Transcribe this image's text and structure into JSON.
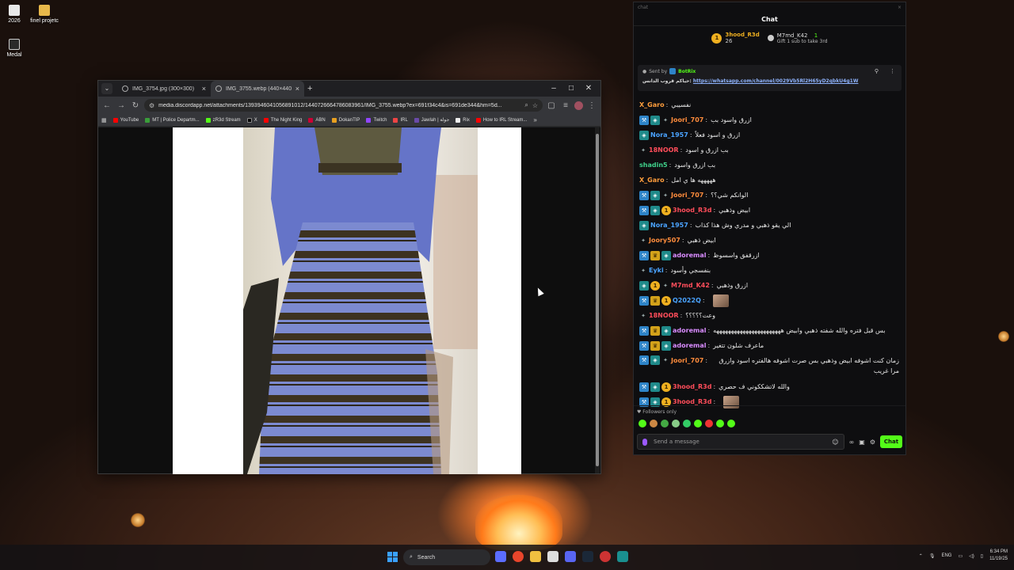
{
  "desktop": {
    "icons": [
      {
        "label": "2026",
        "icon": "file-icon"
      },
      {
        "label": "finel projetc",
        "icon": "folder-icon"
      },
      {
        "label": "Medal",
        "icon": "medal-app-icon"
      }
    ]
  },
  "browser": {
    "tabs": [
      {
        "label": "IMG_3754.jpg (300×300)",
        "active": false
      },
      {
        "label": "IMG_3755.webp (440×440)",
        "active": true
      }
    ],
    "url": "media.discordapp.net/attachments/1393946041056891012/1440726664786083961/IMG_3755.webp?ex=691f34c4&is=691de344&hm=5d...",
    "bookmarks": [
      "YouTube",
      "MT | Police Departm...",
      "zR3d Stream",
      "X",
      "The Night King",
      "ABN",
      "DokanTIP",
      "Twitch",
      "IRL",
      "Jawlah | جولة",
      "Rix",
      "How to IRL Stream..."
    ]
  },
  "chat": {
    "window_title": "chat",
    "header": "Chat",
    "gifters": [
      {
        "rank": "1",
        "name": "3hood_R3d",
        "count": "26"
      },
      {
        "rank": "",
        "name": "M7md_K42",
        "count": "1"
      }
    ],
    "gift_prompt": "Gift 1 sub to take 3rd",
    "pinned": {
      "sent_by_label": "Sent by",
      "sender": "BotRix",
      "text": "حياكم قروب الدانس",
      "link": "https://whatsapp.com/channel/0029Vb5Rl2H65yD2qbkU4g1W"
    },
    "messages": [
      {
        "user": "X_Garo",
        "color": "#ff9d3c",
        "badges": [],
        "text": "نفسيبي"
      },
      {
        "user": "Joori_707",
        "color": "#ff8c3c",
        "badges": [
          "mod",
          "sub",
          "og"
        ],
        "text": "ازرق واسود بب"
      },
      {
        "user": "Nora_1957",
        "color": "#4aa3ff",
        "badges": [
          "sub"
        ],
        "text": "ازرق و اسود فعلاً"
      },
      {
        "user": "18NOOR",
        "color": "#ff4d5a",
        "badges": [
          "og"
        ],
        "text": "بب ازرق و اسود"
      },
      {
        "user": "shadin5",
        "color": "#3fd08a",
        "badges": [],
        "text": "بب ازرق واسود"
      },
      {
        "user": "X_Garo",
        "color": "#ff9d3c",
        "badges": [],
        "text": "هههههه ها ي امل"
      },
      {
        "user": "Joori_707",
        "color": "#ff8c3c",
        "badges": [
          "mod",
          "sub",
          "og"
        ],
        "text": "الوانكم شي؟؟"
      },
      {
        "user": "3hood_R3d",
        "color": "#ff4d5a",
        "badges": [
          "mod",
          "sub",
          "gold"
        ],
        "text": "ابيض وذهبي"
      },
      {
        "user": "Nora_1957",
        "color": "#4aa3ff",
        "badges": [
          "sub"
        ],
        "text": "الي يقو ذهبي و مدري وش هذا كذاب"
      },
      {
        "user": "Joory507",
        "color": "#ff8c3c",
        "badges": [
          "og"
        ],
        "text": "ابيض ذهبي"
      },
      {
        "user": "adoremal",
        "color": "#d98cff",
        "badges": [
          "mod",
          "crown",
          "sub"
        ],
        "text": "ازرقفق واسسوظ"
      },
      {
        "user": "Eyki",
        "color": "#4aa3ff",
        "badges": [
          "og"
        ],
        "text": "بنفسجي وأسود"
      },
      {
        "user": "M7md_K42",
        "color": "#ff4d5a",
        "badges": [
          "sub",
          "gold",
          "og"
        ],
        "text": "ازرق وذهبي"
      },
      {
        "user": "Q2022Q",
        "color": "#4aa3ff",
        "badges": [
          "mod",
          "crown",
          "gold"
        ],
        "text": "",
        "emote": true
      },
      {
        "user": "18NOOR",
        "color": "#ff4d5a",
        "badges": [
          "og"
        ],
        "text": "وعت؟؟؟؟؟"
      },
      {
        "user": "adoremal",
        "color": "#d98cff",
        "badges": [
          "mod",
          "crown",
          "sub"
        ],
        "text": "بس قبل فتره والله شفته ذهبي وابيض هههههههههههههههههههههههه"
      },
      {
        "user": "adoremal",
        "color": "#d98cff",
        "badges": [
          "mod",
          "crown",
          "sub"
        ],
        "text": "ماعرف شلون تتغير"
      },
      {
        "user": "Joori_707",
        "color": "#ff8c3c",
        "badges": [
          "mod",
          "sub",
          "og"
        ],
        "text": "زمان كنت اشوفه ابيض وذهبي بس صرت اشوفه هالفتره اسود وازرق مرا غريب",
        "tall": true
      },
      {
        "user": "3hood_R3d",
        "color": "#ff4d5a",
        "badges": [
          "mod",
          "sub",
          "gold"
        ],
        "text": "والله لاتشككوني ف حصري"
      },
      {
        "user": "3hood_R3d",
        "color": "#ff4d5a",
        "badges": [
          "mod",
          "sub",
          "gold"
        ],
        "text": "",
        "emote": true
      }
    ],
    "followers_only": "Followers only",
    "input_placeholder": "Send a message",
    "send_label": "Chat"
  },
  "taskbar": {
    "search_label": "Search",
    "lang": "ENG",
    "time": "6:34 PM",
    "date": "11/19/25"
  }
}
